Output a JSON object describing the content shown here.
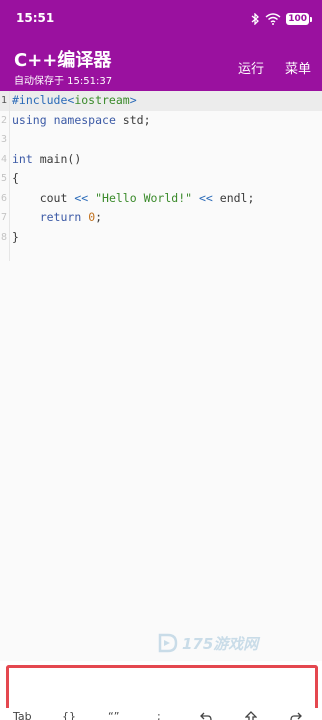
{
  "status": {
    "time": "15:51",
    "battery": "100",
    "icons": [
      "bluetooth-icon",
      "wifi-icon",
      "battery-icon"
    ]
  },
  "appbar": {
    "title": "C++编译器",
    "subtitle": "自动保存于 15:51:37",
    "run_label": "运行",
    "menu_label": "菜单"
  },
  "editor": {
    "line_numbers": [
      "1",
      "2",
      "3",
      "4",
      "5",
      "6",
      "7",
      "8"
    ],
    "lines": [
      "#include<iostream>",
      "using namespace std;",
      "",
      "int main()",
      "{",
      "    cout << \"Hello World!\" << endl;",
      "    return 0;",
      "}"
    ]
  },
  "watermark": {
    "text": "175游戏网",
    "logo": "watermark-logo"
  },
  "shortcut_bar": {
    "keys": [
      "Tab",
      "{}",
      "“”",
      ";",
      "undo-icon",
      "format-icon",
      "redo-icon"
    ]
  },
  "colors": {
    "app_bar": "#9a119f",
    "input_border": "#e4474f",
    "keyword": "#3c5aa6",
    "string": "#3a8a2a",
    "number": "#c0701d"
  }
}
